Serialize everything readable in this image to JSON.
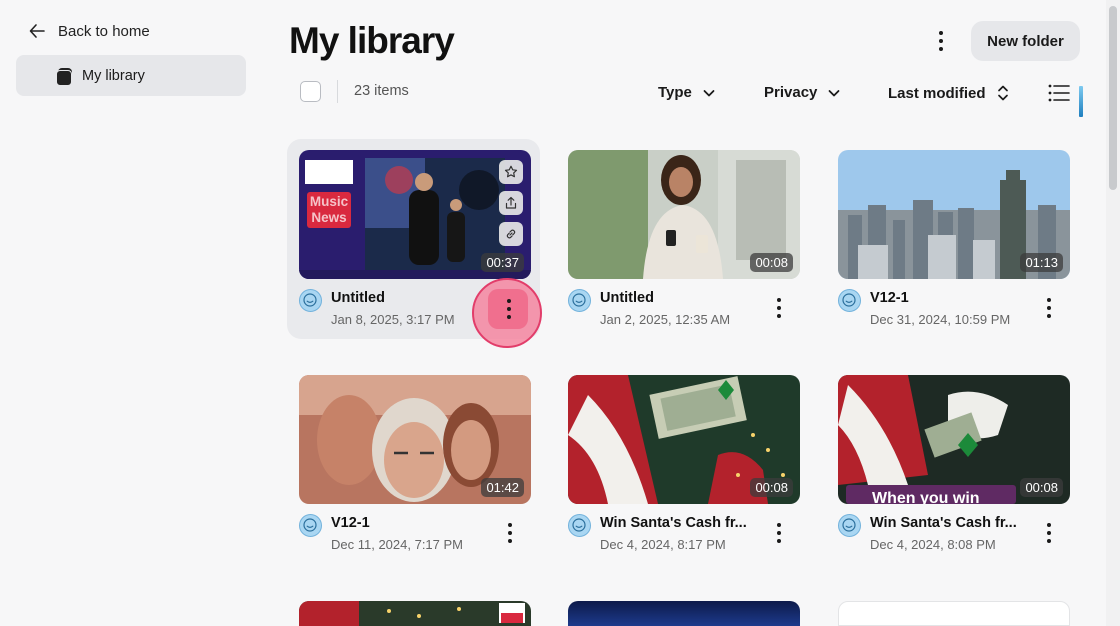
{
  "sidebar": {
    "back_label": "Back to home",
    "items": [
      {
        "label": "My library"
      }
    ]
  },
  "header": {
    "title": "My library",
    "new_folder_label": "New folder"
  },
  "toolbar": {
    "item_count": "23 items",
    "filters": [
      {
        "label": "Type",
        "icon": "chevron-down-icon"
      },
      {
        "label": "Privacy",
        "icon": "chevron-down-icon"
      },
      {
        "label": "Last modified",
        "icon": "sort-icon"
      }
    ]
  },
  "videos": [
    {
      "title": "Untitled",
      "date": "Jan 8, 2025, 3:17 PM",
      "duration": "00:37",
      "thumb_overlay_text": "Music News",
      "selected": true
    },
    {
      "title": "Untitled",
      "date": "Jan 2, 2025, 12:35 AM",
      "duration": "00:08"
    },
    {
      "title": "V12-1",
      "date": "Dec 31, 2024, 10:59 PM",
      "duration": "01:13"
    },
    {
      "title": "V12-1",
      "date": "Dec 11, 2024, 7:17 PM",
      "duration": "01:42"
    },
    {
      "title": "Win Santa's Cash fr...",
      "date": "Dec 4, 2024, 8:17 PM",
      "duration": "00:08"
    },
    {
      "title": "Win Santa's Cash fr...",
      "date": "Dec 4, 2024, 8:08 PM",
      "duration": "00:08",
      "thumb_overlay_text": "When you win"
    }
  ],
  "colors": {
    "accent_highlight": "#e23d6a",
    "avatar": "#a9d6f2",
    "music_news_label": "#d9293f"
  }
}
